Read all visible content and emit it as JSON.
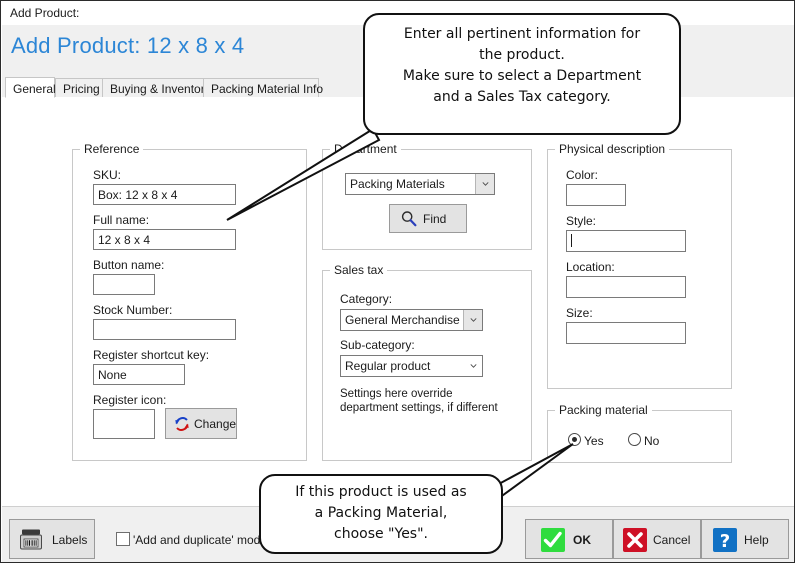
{
  "window": {
    "caption": "Add Product:",
    "header_title": "Add Product: 12 x 8 x 4",
    "accent_color": "#2c86d6"
  },
  "tabs": [
    {
      "label": "General",
      "active": true
    },
    {
      "label": "Pricing",
      "active": false
    },
    {
      "label": "Buying & Inventory",
      "active": false
    },
    {
      "label": "Packing Material Info",
      "active": false
    }
  ],
  "reference": {
    "caption": "Reference",
    "sku_label": "SKU:",
    "sku_value": "Box: 12 x 8 x 4",
    "fullname_label": "Full name:",
    "fullname_value": "12 x 8 x 4",
    "buttonname_label": "Button name:",
    "buttonname_value": "",
    "stocknumber_label": "Stock Number:",
    "stocknumber_value": "",
    "shortcut_label": "Register shortcut key:",
    "shortcut_value": "None",
    "registericon_label": "Register icon:",
    "registericon_value": "",
    "change_button": "Change",
    "change_icon": "refresh-icon"
  },
  "department": {
    "caption": "Department",
    "value": "Packing Materials",
    "find_button": "Find",
    "find_icon": "magnifier-icon"
  },
  "sales_tax": {
    "caption": "Sales tax",
    "category_label": "Category:",
    "category_value": "General Merchandise",
    "subcategory_label": "Sub-category:",
    "subcategory_value": "Regular product",
    "note_line1": "Settings here override",
    "note_line2": "department settings, if different"
  },
  "physical": {
    "caption": "Physical description",
    "color_label": "Color:",
    "color_value": "",
    "style_label": "Style:",
    "style_value": "",
    "location_label": "Location:",
    "location_value": "",
    "size_label": "Size:",
    "size_value": ""
  },
  "packing_material": {
    "caption": "Packing material",
    "yes_label": "Yes",
    "no_label": "No",
    "selected": "Yes"
  },
  "bottom_bar": {
    "labels_button": "Labels",
    "labels_icon": "label-printer-icon",
    "duplicate_mode_label": "'Add and duplicate' mode",
    "duplicate_mode_checked": false,
    "ok_button": "OK",
    "ok_icon": "green-check-icon",
    "cancel_button": "Cancel",
    "cancel_icon": "red-x-icon",
    "help_button": "Help",
    "help_icon": "blue-question-icon"
  },
  "callouts": [
    {
      "name": "top-callout",
      "lines": [
        "Enter all pertinent information for",
        "the product.",
        "Make sure to select a Department",
        "and a Sales Tax category."
      ]
    },
    {
      "name": "bottom-callout",
      "lines": [
        "If this product is used as",
        "a Packing Material,",
        "choose \"Yes\"."
      ]
    }
  ]
}
